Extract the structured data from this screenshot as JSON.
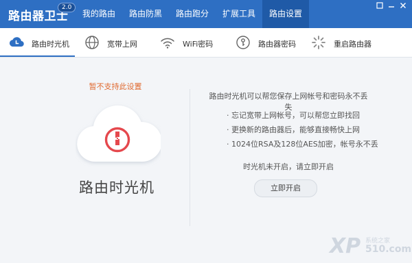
{
  "app": {
    "title": "路由器卫士",
    "version": "2.0"
  },
  "nav": {
    "tabs": [
      {
        "label": "我的路由"
      },
      {
        "label": "路由防黑"
      },
      {
        "label": "路由跑分"
      },
      {
        "label": "扩展工具"
      },
      {
        "label": "路由设置",
        "active": true
      }
    ]
  },
  "window_controls": [
    "restore-icon",
    "minimize-icon",
    "close-icon"
  ],
  "subnav": {
    "tabs": [
      {
        "label": "路由时光机",
        "icon": "clock-cloud-icon",
        "active": true
      },
      {
        "label": "宽带上网",
        "icon": "globe-icon"
      },
      {
        "label": "WiFi密码",
        "icon": "wifi-icon"
      },
      {
        "label": "路由器密码",
        "icon": "key-icon"
      },
      {
        "label": "重启路由器",
        "icon": "spinner-icon"
      }
    ]
  },
  "left_panel": {
    "warning": "暂不支持此设置",
    "feature_title": "路由时光机",
    "feature_icon": "cloud-timemachine-icon"
  },
  "right_panel": {
    "headline": "路由时光机可以帮您保存上网帐号和密码永不丢失",
    "bullets": [
      "· 忘记宽带上网帐号，可以帮您立即找回",
      "· 更换新的路由器后，能够直接畅快上网",
      "· 1024位RSA及128位AES加密，帐号永不丢"
    ],
    "status": "时光机未开启，请立即开启",
    "button": "立即开启"
  },
  "watermark": {
    "xp": "XP",
    "top": "系统之家",
    "num": "510.com"
  },
  "colors": {
    "accent": "#2e6fc3",
    "warning": "#e0692f",
    "icon_red": "#e5484d"
  }
}
